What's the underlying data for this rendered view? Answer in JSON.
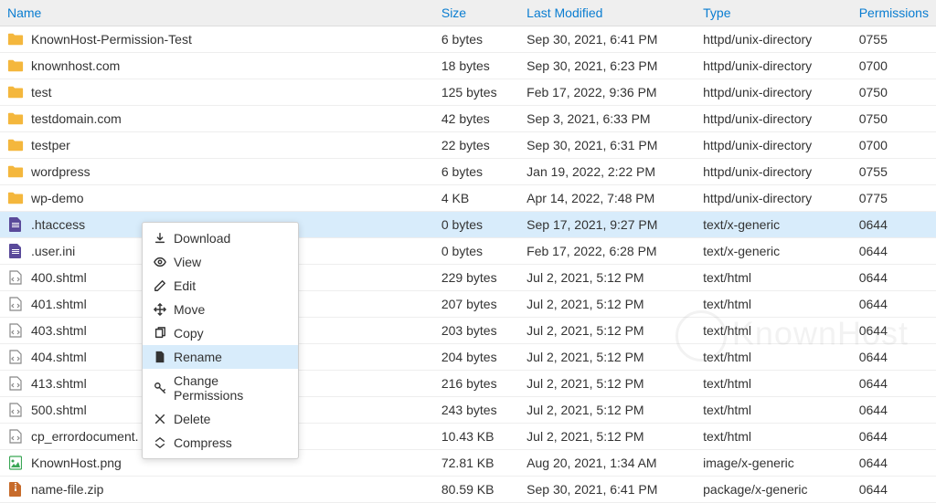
{
  "headers": {
    "name": "Name",
    "size": "Size",
    "modified": "Last Modified",
    "type": "Type",
    "permissions": "Permissions"
  },
  "rows": [
    {
      "icon": "folder",
      "name": "KnownHost-Permission-Test",
      "size": "6 bytes",
      "modified": "Sep 30, 2021, 6:41 PM",
      "type": "httpd/unix-directory",
      "perm": "0755",
      "selected": false
    },
    {
      "icon": "folder",
      "name": "knownhost.com",
      "size": "18 bytes",
      "modified": "Sep 30, 2021, 6:23 PM",
      "type": "httpd/unix-directory",
      "perm": "0700",
      "selected": false
    },
    {
      "icon": "folder",
      "name": "test",
      "size": "125 bytes",
      "modified": "Feb 17, 2022, 9:36 PM",
      "type": "httpd/unix-directory",
      "perm": "0750",
      "selected": false
    },
    {
      "icon": "folder",
      "name": "testdomain.com",
      "size": "42 bytes",
      "modified": "Sep 3, 2021, 6:33 PM",
      "type": "httpd/unix-directory",
      "perm": "0750",
      "selected": false
    },
    {
      "icon": "folder",
      "name": "testper",
      "size": "22 bytes",
      "modified": "Sep 30, 2021, 6:31 PM",
      "type": "httpd/unix-directory",
      "perm": "0700",
      "selected": false
    },
    {
      "icon": "folder",
      "name": "wordpress",
      "size": "6 bytes",
      "modified": "Jan 19, 2022, 2:22 PM",
      "type": "httpd/unix-directory",
      "perm": "0755",
      "selected": false
    },
    {
      "icon": "folder",
      "name": "wp-demo",
      "size": "4 KB",
      "modified": "Apr 14, 2022, 7:48 PM",
      "type": "httpd/unix-directory",
      "perm": "0775",
      "selected": false
    },
    {
      "icon": "textfile",
      "name": ".htaccess",
      "size": "0 bytes",
      "modified": "Sep 17, 2021, 9:27 PM",
      "type": "text/x-generic",
      "perm": "0644",
      "selected": true
    },
    {
      "icon": "textfile",
      "name": ".user.ini",
      "size": "0 bytes",
      "modified": "Feb 17, 2022, 6:28 PM",
      "type": "text/x-generic",
      "perm": "0644",
      "selected": false
    },
    {
      "icon": "codefile",
      "name": "400.shtml",
      "size": "229 bytes",
      "modified": "Jul 2, 2021, 5:12 PM",
      "type": "text/html",
      "perm": "0644",
      "selected": false
    },
    {
      "icon": "codefile",
      "name": "401.shtml",
      "size": "207 bytes",
      "modified": "Jul 2, 2021, 5:12 PM",
      "type": "text/html",
      "perm": "0644",
      "selected": false
    },
    {
      "icon": "codefile",
      "name": "403.shtml",
      "size": "203 bytes",
      "modified": "Jul 2, 2021, 5:12 PM",
      "type": "text/html",
      "perm": "0644",
      "selected": false
    },
    {
      "icon": "codefile",
      "name": "404.shtml",
      "size": "204 bytes",
      "modified": "Jul 2, 2021, 5:12 PM",
      "type": "text/html",
      "perm": "0644",
      "selected": false
    },
    {
      "icon": "codefile",
      "name": "413.shtml",
      "size": "216 bytes",
      "modified": "Jul 2, 2021, 5:12 PM",
      "type": "text/html",
      "perm": "0644",
      "selected": false
    },
    {
      "icon": "codefile",
      "name": "500.shtml",
      "size": "243 bytes",
      "modified": "Jul 2, 2021, 5:12 PM",
      "type": "text/html",
      "perm": "0644",
      "selected": false
    },
    {
      "icon": "codefile",
      "name": "cp_errordocument.",
      "size": "10.43 KB",
      "modified": "Jul 2, 2021, 5:12 PM",
      "type": "text/html",
      "perm": "0644",
      "selected": false
    },
    {
      "icon": "image",
      "name": "KnownHost.png",
      "size": "72.81 KB",
      "modified": "Aug 20, 2021, 1:34 AM",
      "type": "image/x-generic",
      "perm": "0644",
      "selected": false
    },
    {
      "icon": "zip",
      "name": "name-file.zip",
      "size": "80.59 KB",
      "modified": "Sep 30, 2021, 6:41 PM",
      "type": "package/x-generic",
      "perm": "0644",
      "selected": false
    }
  ],
  "context_menu": {
    "items": [
      {
        "icon": "download",
        "label": "Download",
        "highlighted": false
      },
      {
        "icon": "eye",
        "label": "View",
        "highlighted": false
      },
      {
        "icon": "pencil",
        "label": "Edit",
        "highlighted": false
      },
      {
        "icon": "move",
        "label": "Move",
        "highlighted": false
      },
      {
        "icon": "copy",
        "label": "Copy",
        "highlighted": false
      },
      {
        "icon": "file",
        "label": "Rename",
        "highlighted": true
      },
      {
        "icon": "key",
        "label": "Change Permissions",
        "highlighted": false
      },
      {
        "icon": "close",
        "label": "Delete",
        "highlighted": false
      },
      {
        "icon": "compress",
        "label": "Compress",
        "highlighted": false
      }
    ]
  },
  "watermark": "KnownHost"
}
